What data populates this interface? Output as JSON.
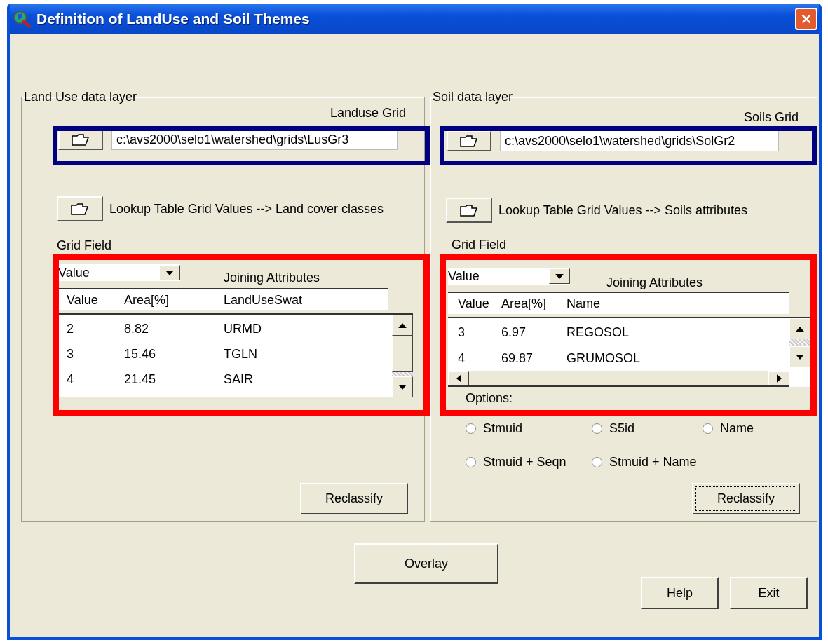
{
  "window": {
    "title": "Definition of LandUse and Soil Themes"
  },
  "land_use": {
    "legend": "Land Use data layer",
    "grid_label": "Landuse Grid",
    "grid_path": "c:\\avs2000\\selo1\\watershed\\grids\\LusGr3",
    "lookup_label": "Lookup Table  Grid Values --> Land cover classes",
    "grid_field_label": "Grid Field",
    "grid_field_value": "Value",
    "joining_label": "Joining Attributes",
    "columns": [
      "Value",
      "Area[%]",
      "LandUseSwat"
    ],
    "rows": [
      [
        "2",
        "8.82",
        "URMD"
      ],
      [
        "3",
        "15.46",
        "TGLN"
      ],
      [
        "4",
        "21.45",
        "SAIR"
      ]
    ],
    "reclassify": {
      "label": "Reclassify",
      "focused": false
    }
  },
  "soil": {
    "legend": "Soil data layer",
    "grid_label": "Soils Grid",
    "grid_path": "c:\\avs2000\\selo1\\watershed\\grids\\SolGr2",
    "lookup_label": "Lookup Table  Grid Values --> Soils attributes",
    "grid_field_label": "Grid Field",
    "grid_field_value": "Value",
    "joining_label": "Joining Attributes",
    "columns": [
      "Value",
      "Area[%]",
      "Name"
    ],
    "rows": [
      [
        "3",
        "6.97",
        "REGOSOL"
      ],
      [
        "4",
        "69.87",
        "GRUMOSOL"
      ]
    ],
    "options_label": "Options:",
    "options": [
      {
        "label": "Stmuid",
        "selected": false
      },
      {
        "label": "S5id",
        "selected": false
      },
      {
        "label": "Name",
        "selected": false
      },
      {
        "label": "Stmuid + Seqn",
        "selected": false
      },
      {
        "label": "Stmuid + Name",
        "selected": false
      }
    ],
    "reclassify": {
      "label": "Reclassify",
      "focused": true
    }
  },
  "overlay": "Overlay",
  "help": "Help",
  "exit": "Exit",
  "markups": [
    {
      "color": "#000080"
    },
    {
      "color": "#000080"
    },
    {
      "color": "#ff0000"
    },
    {
      "color": "#ff0000"
    }
  ]
}
